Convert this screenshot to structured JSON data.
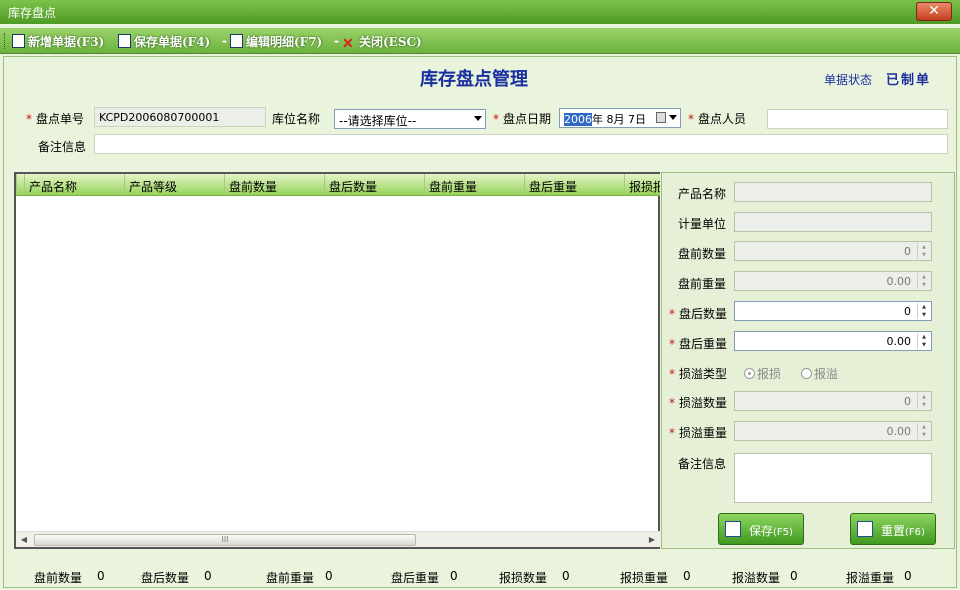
{
  "window": {
    "title": "库存盘点",
    "close_label": "✕"
  },
  "toolbar": {
    "new_label": "新增单据(F3)",
    "save_label": "保存单据(F4)",
    "edit_label": "编辑明细(F7)",
    "close_label": "关闭(ESC)",
    "separator": "-"
  },
  "header": {
    "page_title": "库存盘点管理",
    "status_label": "单据状态",
    "status_value": "已制单"
  },
  "form": {
    "required_mark": "*",
    "doc_no_label": "盘点单号",
    "doc_no_value": "KCPD2006080700001",
    "location_label": "库位名称",
    "location_value": "--请选择库位--",
    "date_label": "盘点日期",
    "date_year_selected": "2006",
    "date_rest": "年  8月  7日",
    "person_label": "盘点人员",
    "person_value": "",
    "remark_label": "备注信息",
    "remark_value": ""
  },
  "grid": {
    "columns": [
      "产品名称",
      "产品等级",
      "盘前数量",
      "盘后数量",
      "盘前重量",
      "盘后重量",
      "报损报"
    ],
    "rows": []
  },
  "detail": {
    "product_name_label": "产品名称",
    "unit_label": "计量单位",
    "before_qty_label": "盘前数量",
    "before_qty_value": "0",
    "before_weight_label": "盘前重量",
    "before_weight_value": "0.00",
    "after_qty_label": "盘后数量",
    "after_qty_value": "0",
    "after_weight_label": "盘后重量",
    "after_weight_value": "0.00",
    "type_label": "损溢类型",
    "type_loss": "报损",
    "type_gain": "报溢",
    "pl_qty_label": "损溢数量",
    "pl_qty_value": "0",
    "pl_weight_label": "损溢重量",
    "pl_weight_value": "0.00",
    "remark_label": "备注信息",
    "save_button": "保存",
    "save_hotkey": "(F5)",
    "reset_button": "重置",
    "reset_hotkey": "(F6)"
  },
  "footer": [
    {
      "label": "盘前数量",
      "value": "0"
    },
    {
      "label": "盘后数量",
      "value": "0"
    },
    {
      "label": "盘前重量",
      "value": "0"
    },
    {
      "label": "盘后重量",
      "value": "0"
    },
    {
      "label": "报损数量",
      "value": "0"
    },
    {
      "label": "报损重量",
      "value": "0"
    },
    {
      "label": "报溢数量",
      "value": "0"
    },
    {
      "label": "报溢重量",
      "value": "0"
    }
  ],
  "colors": {
    "accent": "#1a2fa0",
    "required": "#d01010",
    "toolbar": "#6cb23e"
  }
}
